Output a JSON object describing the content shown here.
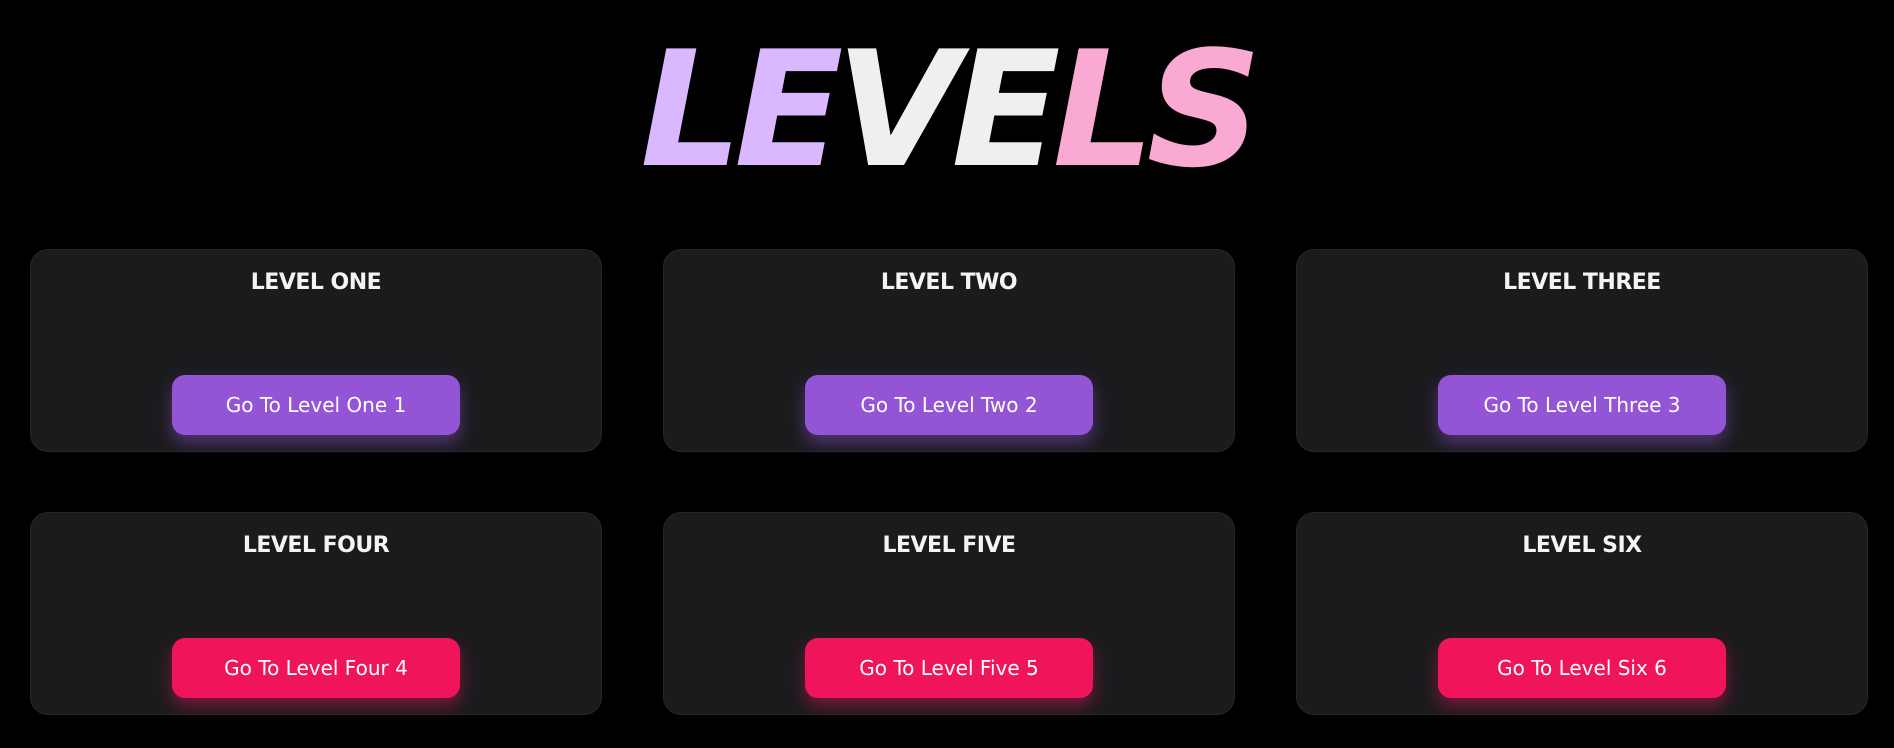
{
  "title": {
    "letters": [
      {
        "char": "L",
        "color": "#d9b8ff"
      },
      {
        "char": "E",
        "color": "#d9b8ff"
      },
      {
        "char": "V",
        "color": "#eeeff0"
      },
      {
        "char": "E",
        "color": "#eeeff0"
      },
      {
        "char": "L",
        "color": "#f9a9d2"
      },
      {
        "char": "S",
        "color": "#f9a9d2"
      }
    ]
  },
  "colors": {
    "background": "#000000",
    "card": "#1b1b1e",
    "purple_button": "#9355d6",
    "pink_button": "#f0145a"
  },
  "levels": [
    {
      "title": "LEVEL ONE",
      "button": "Go To Level One 1",
      "button_color": "purple"
    },
    {
      "title": "LEVEL TWO",
      "button": "Go To Level Two 2",
      "button_color": "purple"
    },
    {
      "title": "LEVEL THREE",
      "button": "Go To Level Three 3",
      "button_color": "purple"
    },
    {
      "title": "LEVEL FOUR",
      "button": "Go To Level Four 4",
      "button_color": "pink"
    },
    {
      "title": "LEVEL FIVE",
      "button": "Go To Level Five 5",
      "button_color": "pink"
    },
    {
      "title": "LEVEL SIX",
      "button": "Go To Level Six 6",
      "button_color": "pink"
    }
  ]
}
